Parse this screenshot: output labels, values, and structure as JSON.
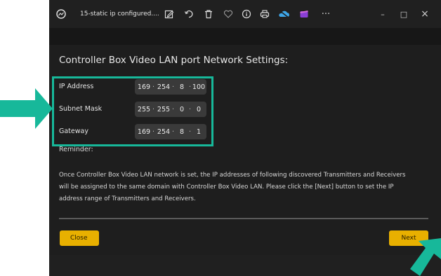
{
  "titlebar": {
    "title": "15-static ip configured....",
    "more_label": "···",
    "minimize_label": "–",
    "maximize_label": "□",
    "close_label": "×"
  },
  "dialog": {
    "heading": "Controller Box Video LAN port Network Settings:",
    "fields": [
      {
        "label": "IP Address",
        "octets": [
          "169",
          "254",
          "8",
          "100"
        ]
      },
      {
        "label": "Subnet Mask",
        "octets": [
          "255",
          "255",
          "0",
          "0"
        ]
      },
      {
        "label": "Gateway",
        "octets": [
          "169",
          "254",
          "8",
          "1"
        ]
      }
    ],
    "reminder_label": "Reminder:",
    "message_lines": [
      "Once Controller Box Video LAN network is set, the IP addresses of following discovered Transmitters and Receivers",
      "will be assigned to the same domain with Controller Box Video LAN. Please click the [Next] button to set the IP",
      "address range of Transmitters and Receivers."
    ],
    "close_label": "Close",
    "next_label": "Next"
  },
  "colors": {
    "accent_button": "#e8b000",
    "highlight": "#17b89a",
    "background": "#171717"
  },
  "icons": [
    "app-icon",
    "edit-icon",
    "rotate-icon",
    "delete-icon",
    "heart-icon",
    "info-icon",
    "print-icon",
    "cloud-icon",
    "clipchamp-icon",
    "more-icon"
  ]
}
